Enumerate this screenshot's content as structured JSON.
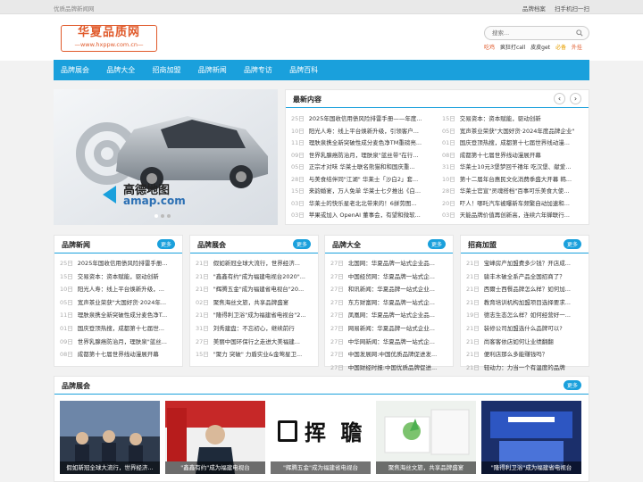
{
  "topbar": {
    "left": "优质品牌新闻网",
    "links": [
      "品牌档案",
      "扫手机扫一扫"
    ]
  },
  "logo": {
    "title": "华夏品质网",
    "url": "—www.hxppw.com.cn—"
  },
  "search": {
    "placeholder": "搜索...",
    "hot": [
      "吃鸡",
      "疯狂打call",
      "皮皮get",
      "必备",
      "外挂"
    ]
  },
  "nav": [
    "品牌展会",
    "品牌大全",
    "招商加盟",
    "品牌新闻",
    "品牌专访",
    "品牌百科"
  ],
  "slider": {
    "brand_cn": "高德地图",
    "brand_en": "amap.com"
  },
  "latest": {
    "title": "最新内容",
    "left": [
      {
        "d": "25日",
        "t": "2025年国收信用债风险排雷手册——年度..."
      },
      {
        "d": "10日",
        "t": "阳光人寿：线上平台焕新升级，引领客户..."
      },
      {
        "d": "11日",
        "t": "理肤泉携全新突破性成分麦色净TM重磅亮..."
      },
      {
        "d": "09日",
        "t": "世界乳腺癌防治月，理肤泉\"蓝丝带\"在行..."
      },
      {
        "d": "05日",
        "t": "正宗才对味 华莱士联名熊猫和和国庆重..."
      },
      {
        "d": "28日",
        "t": "与美食结伴同\"江湖\" 华莱士「沙白2」套..."
      },
      {
        "d": "15日",
        "t": "来韵婚宴，万人免单 华莱士七夕推出《白..."
      },
      {
        "d": "03日",
        "t": "华莱士的快乐星老北北带来的！6拼劳图..."
      },
      {
        "d": "03日",
        "t": "苹果或加入 OpenAI 董事会，有望和微软..."
      }
    ],
    "right": [
      {
        "d": "15日",
        "t": "交易资本：资本赋能，驱动创新"
      },
      {
        "d": "05日",
        "t": "宽声茶业荣获\"大国好货·2024年度品牌企业\""
      },
      {
        "d": "01日",
        "t": "国庆登顶热搜，成都第十七届世界线动漫..."
      },
      {
        "d": "08日",
        "t": "成都第十七届世界线动漫展开幕"
      },
      {
        "d": "31日",
        "t": "华莱士10元3堡梦回千禧年 吃汉堡、献爱..."
      },
      {
        "d": "10日",
        "t": "第十二届年台惠民文化消费季盛大开幕 韩..."
      },
      {
        "d": "28日",
        "t": "华莱士官宣\"灵魂搭档\"百事可乐美食大使..."
      },
      {
        "d": "20日",
        "t": "吓人！哪吒汽车被曝新车频繁自动加速和..."
      },
      {
        "d": "03日",
        "t": "天能品牌价值再创新高，连续六年蝉联行..."
      }
    ]
  },
  "boxes": [
    {
      "title": "品牌新闻",
      "more": "更多",
      "items": [
        {
          "d": "25日",
          "t": "2025年国收信用债风险排雷手册..."
        },
        {
          "d": "15日",
          "t": "交易资本：资本赋能，驱动创新"
        },
        {
          "d": "10日",
          "t": "阳光人寿：线上平台焕新升级，..."
        },
        {
          "d": "05日",
          "t": "宽声茶业荣获\"大国好货·2024年..."
        },
        {
          "d": "11日",
          "t": "理肤泉携全新突破性成分麦色净T..."
        },
        {
          "d": "01日",
          "t": "国庆登顶热搜，成都第十七届世..."
        },
        {
          "d": "09日",
          "t": "世界乳腺癌防治月，理肤泉\"蓝丝..."
        },
        {
          "d": "08日",
          "t": "成都第十七届世界线动漫展开幕"
        }
      ]
    },
    {
      "title": "品牌展会",
      "more": "更多",
      "items": [
        {
          "d": "21日",
          "t": "假如新冠全球大流行，世界经济..."
        },
        {
          "d": "21日",
          "t": "\"鑫鑫有约\"成为福建电视台2020\"..."
        },
        {
          "d": "21日",
          "t": "\"辉腾五金\"成为福建省电视台\"20..."
        },
        {
          "d": "02日",
          "t": "聚焦海丝文旅，共享品牌盛宴"
        },
        {
          "d": "21日",
          "t": "\"隆得利卫浴\"成为福建省电视台\"2..."
        },
        {
          "d": "31日",
          "t": "刘秀建盘：不忘初心，继续前行"
        },
        {
          "d": "27日",
          "t": "美丽中国环保行之走进大美福建..."
        },
        {
          "d": "15日",
          "t": "\"聚力 突破\" 力盾实业&金莺星卫..."
        }
      ]
    },
    {
      "title": "品牌大全",
      "more": "更多",
      "items": [
        {
          "d": "27日",
          "t": "北国网：华夏品牌一站式企业品..."
        },
        {
          "d": "27日",
          "t": "中国经贸网：华夏品牌一站式企..."
        },
        {
          "d": "27日",
          "t": "和讯新闻：华夏品牌一站式企业..."
        },
        {
          "d": "27日",
          "t": "东方财富网：华夏品牌一站式企..."
        },
        {
          "d": "27日",
          "t": "凤凰网：华夏品牌一站式企业品..."
        },
        {
          "d": "27日",
          "t": "网易新闻：华夏品牌一站式企业..."
        },
        {
          "d": "27日",
          "t": "中华网新闻：华夏品牌一站式企..."
        },
        {
          "d": "27日",
          "t": "中国发展网:中国优质品牌促进发..."
        },
        {
          "d": "27日",
          "t": "中国财经时报:中国优质品牌促进..."
        }
      ]
    },
    {
      "title": "招商加盟",
      "more": "更多",
      "items": [
        {
          "d": "21日",
          "t": "宝峰房产加盟费多少钱？开店成..."
        },
        {
          "d": "21日",
          "t": "骏丰木破全系产品全国招商了？"
        },
        {
          "d": "21日",
          "t": "西爾士西餐品牌怎么样？如何加..."
        },
        {
          "d": "21日",
          "t": "教育培训机构加盟项目选择要求..."
        },
        {
          "d": "19日",
          "t": "德志生态怎么样？如何经营好一..."
        },
        {
          "d": "21日",
          "t": "装修公司加盟选什么品牌可以?"
        },
        {
          "d": "21日",
          "t": "尚客客依店如何让业绩翻翻"
        },
        {
          "d": "21日",
          "t": "便利店那么多能赚钱吗？"
        },
        {
          "d": "21日",
          "t": "轻动力：力当一个有温度的品牌"
        }
      ]
    }
  ],
  "expo": {
    "title": "品牌展会",
    "more": "更多",
    "items": [
      "假如新冠全球大流行，世界经济...",
      "\"鑫鑫有约\"成为福建电视台",
      "\"辉腾五金\"成为福建省电视台",
      "聚焦海丝文旅，共享品牌盛宴",
      "\"隆得利卫浴\"成为福建省电视台"
    ],
    "logo_text": "挥 聸"
  },
  "colors": {
    "accent": "#1aa0dc",
    "brand": "#e05a2b"
  }
}
